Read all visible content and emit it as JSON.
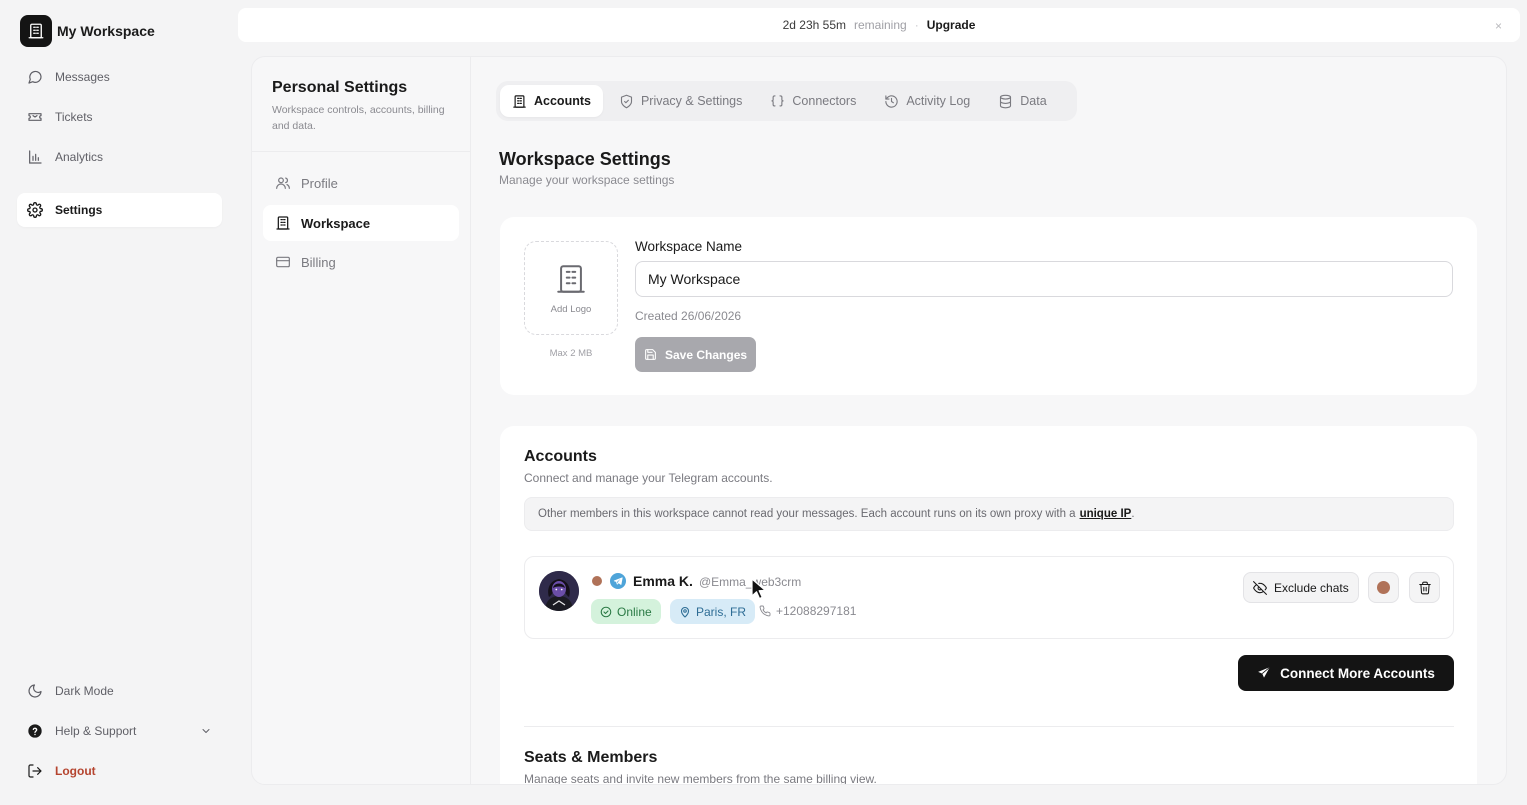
{
  "brand": {
    "name": "My Workspace",
    "icon": "building-icon"
  },
  "nav": {
    "items": [
      {
        "label": "Messages",
        "icon": "chat-bubble-icon"
      },
      {
        "label": "Tickets",
        "icon": "ticket-icon"
      },
      {
        "label": "Analytics",
        "icon": "bar-chart-icon"
      },
      {
        "label": "Settings",
        "icon": "gear-icon",
        "active": true
      }
    ],
    "bottom": [
      {
        "label": "Dark Mode",
        "icon": "moon-icon"
      },
      {
        "label": "Help & Support",
        "icon": "help-circle-icon"
      },
      {
        "label": "Logout",
        "icon": "logout-icon"
      }
    ]
  },
  "banner": {
    "time": "2d 23h 55m",
    "remaining": "remaining",
    "separator": "·",
    "upgrade": "Upgrade",
    "close": "×"
  },
  "subnav": {
    "title": "Personal Settings",
    "description": "Workspace controls, accounts, billing and data.",
    "items": [
      {
        "label": "Profile",
        "icon": "users-icon"
      },
      {
        "label": "Workspace",
        "icon": "building-icon",
        "active": true
      },
      {
        "label": "Billing",
        "icon": "credit-card-icon"
      }
    ]
  },
  "tabs": [
    {
      "label": "Accounts",
      "icon": "building-icon",
      "active": true
    },
    {
      "label": "Privacy & Settings",
      "icon": "shield-icon"
    },
    {
      "label": "Connectors",
      "icon": "braces-icon"
    },
    {
      "label": "Activity Log",
      "icon": "history-icon"
    },
    {
      "label": "Data",
      "icon": "database-icon"
    }
  ],
  "workspace": {
    "title": "Workspace Settings",
    "description": "Manage your workspace settings",
    "add_logo": "Add Logo",
    "max_size": "Max 2 MB",
    "name_label": "Workspace Name",
    "name_value": "My Workspace",
    "created": "Created 26/06/2026",
    "save": "Save Changes"
  },
  "accounts": {
    "title": "Accounts",
    "description": "Connect and manage your Telegram accounts.",
    "notice": "Other members in this workspace cannot read your messages. Each account runs on its own proxy with a",
    "notice_link": "unique IP",
    "notice_end": ".",
    "list": [
      {
        "name": "Emma K.",
        "handle": "@Emma_web3crm",
        "status": "Online",
        "location": "Paris, FR",
        "phone": "+12088297181",
        "status_color": "#b07258"
      }
    ],
    "exclude": "Exclude chats",
    "connect": "Connect More Accounts"
  },
  "seats": {
    "title": "Seats & Members",
    "description": "Manage seats and invite new members from the same billing view."
  },
  "colors": {
    "accent_dark": "#141414",
    "online_bg": "#d4f2dc",
    "location_bg": "#d7ebf7",
    "account_color": "#b07258",
    "logout": "#b5442f"
  }
}
